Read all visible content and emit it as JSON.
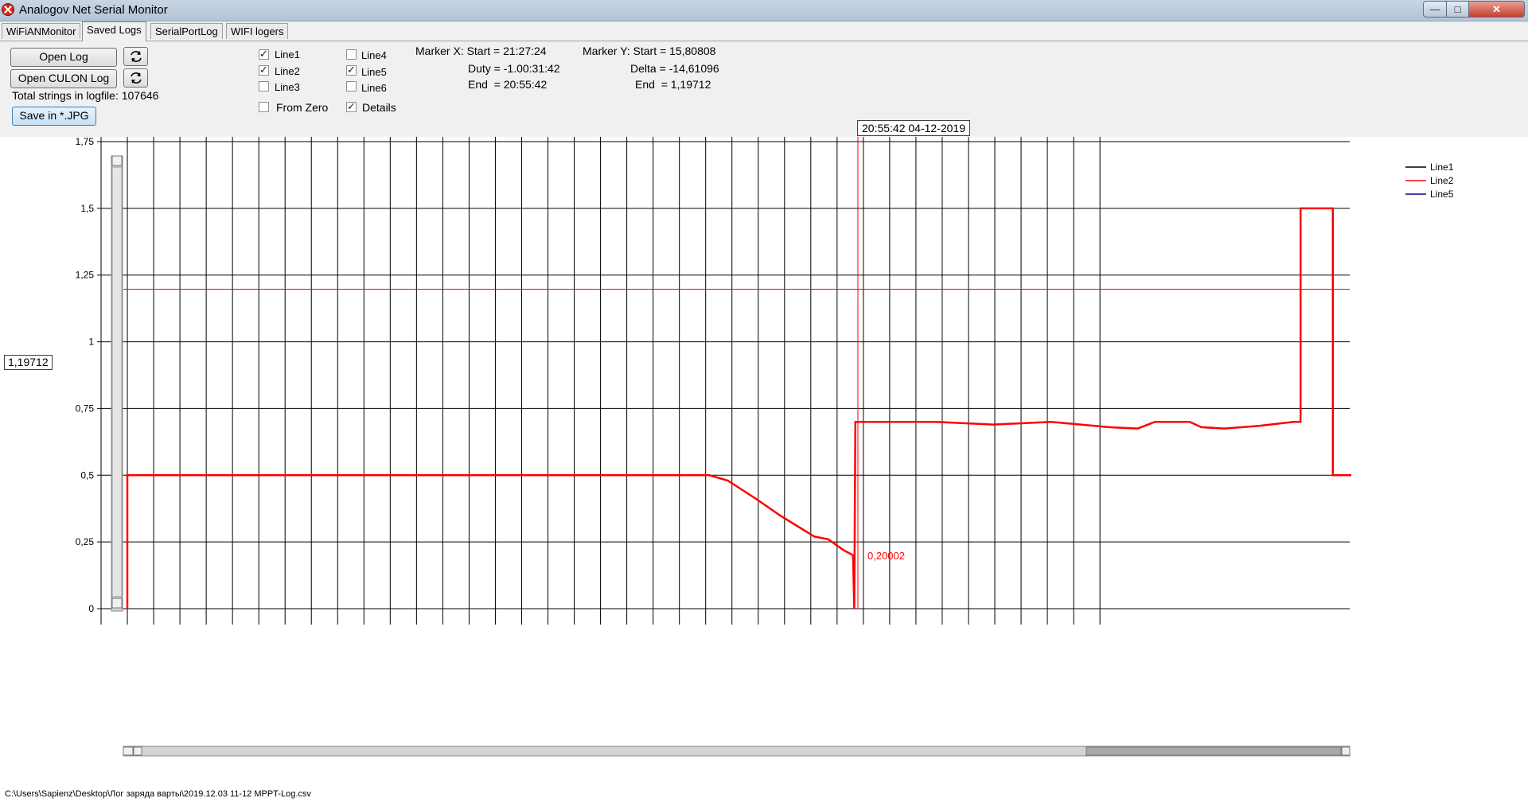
{
  "window": {
    "title": "Analogov Net Serial Monitor"
  },
  "tabs": [
    {
      "label": "WiFiANMonitor",
      "active": false
    },
    {
      "label": "Saved Logs",
      "active": true
    },
    {
      "label": "SerialPortLog",
      "active": false
    },
    {
      "label": "WIFI logers",
      "active": false
    }
  ],
  "controls": {
    "open_log": "Open Log",
    "open_culon_log": "Open CULON Log",
    "total_strings": "Total strings in logfile: 107646",
    "save_jpg": "Save in *.JPG"
  },
  "checkboxes": [
    {
      "label": "Line1",
      "checked": true
    },
    {
      "label": "Line2",
      "checked": true
    },
    {
      "label": "Line3",
      "checked": false
    },
    {
      "label": "Line4",
      "checked": false
    },
    {
      "label": "Line5",
      "checked": true
    },
    {
      "label": "Line6",
      "checked": false
    },
    {
      "label": "From Zero",
      "checked": false
    },
    {
      "label": "Details",
      "checked": true
    }
  ],
  "marker_x": {
    "start": "Marker X: Start = 21:27:24",
    "duty": "Duty = -1.00:31:42",
    "end": "End  = 20:55:42"
  },
  "marker_y": {
    "start": "Marker Y: Start = 15,80808",
    "delta": "Delta = -14,61096",
    "end": "End  = 1,19712"
  },
  "cursor_time": "20:55:42 04-12-2019",
  "cursor_value": "1,19712",
  "file_path": "C:\\Users\\Sapienz\\Desktop\\Лог заряда варты\\2019.12.03 11-12 MPPT-Log.csv",
  "colors": {
    "line2": "#ff0000",
    "line1": "#000000",
    "line5": "#000080",
    "grid": "#000000"
  },
  "chart_data": {
    "type": "line",
    "y_ticks": [
      "0",
      "0,25",
      "0,5",
      "0,75",
      "1",
      "1,25",
      "1,5",
      "1,75"
    ],
    "ylim": [
      0,
      1.8
    ],
    "legend": [
      {
        "name": "Line1",
        "color": "#000000"
      },
      {
        "name": "Line2",
        "color": "#ff0000"
      },
      {
        "name": "Line5",
        "color": "#000080"
      }
    ],
    "legend_position": "top-right",
    "horizontal_marker": 1.19712,
    "vertical_marker_label": "0,20002",
    "series": [
      {
        "name": "Line2",
        "color": "#ff0000",
        "points": [
          [
            0.0,
            0.0
          ],
          [
            0.0,
            0.5
          ],
          [
            0.504,
            0.5
          ],
          [
            0.52,
            0.48
          ],
          [
            0.545,
            0.41
          ],
          [
            0.565,
            0.35
          ],
          [
            0.58,
            0.31
          ],
          [
            0.595,
            0.27
          ],
          [
            0.607,
            0.26
          ],
          [
            0.62,
            0.22
          ],
          [
            0.6285,
            0.2
          ],
          [
            0.6285,
            0.2
          ],
          [
            0.6295,
            0.0
          ],
          [
            0.6305,
            0.7
          ],
          [
            0.7,
            0.7
          ],
          [
            0.75,
            0.69
          ],
          [
            0.8,
            0.7
          ],
          [
            0.85,
            0.68
          ],
          [
            0.875,
            0.675
          ],
          [
            0.89,
            0.7
          ],
          [
            0.92,
            0.7
          ],
          [
            0.93,
            0.68
          ],
          [
            0.95,
            0.675
          ],
          [
            0.98,
            0.685
          ],
          [
            1.01,
            0.7
          ],
          [
            1.016,
            0.7
          ],
          [
            1.016,
            1.5
          ],
          [
            1.044,
            1.5
          ],
          [
            1.044,
            0.5
          ],
          [
            1.06,
            0.5
          ]
        ]
      }
    ]
  }
}
